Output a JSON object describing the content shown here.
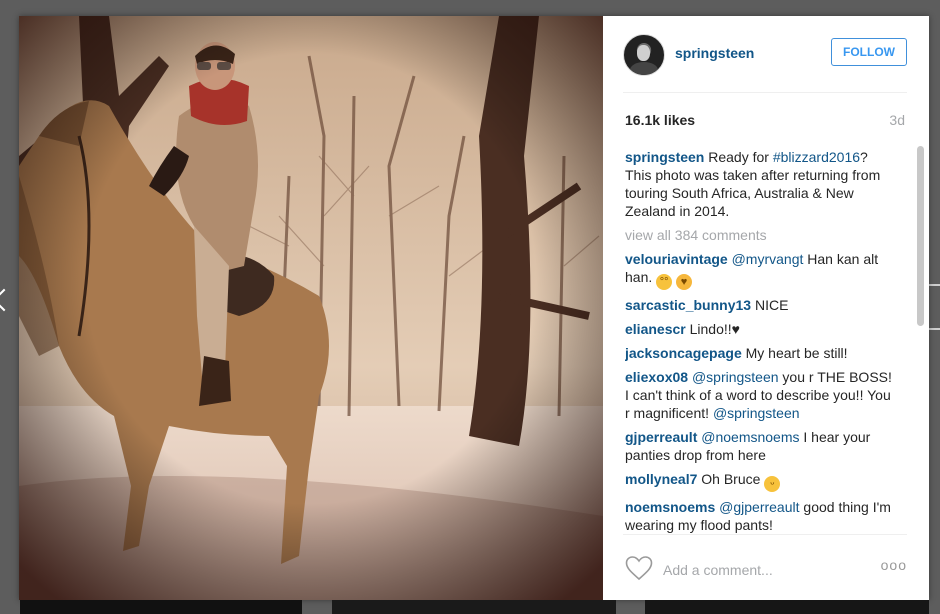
{
  "post": {
    "username": "springsteen",
    "follow_label": "FOLLOW",
    "likes": "16.1k likes",
    "age": "3d",
    "caption": {
      "user": "springsteen",
      "text_before": "Ready for ",
      "hashtag": "#blizzard2016",
      "text_after": "? This photo was taken after returning from touring South Africa, Australia & New Zealand in 2014."
    },
    "view_all": "view all 384 comments"
  },
  "comments": [
    {
      "user": "velouriavintage",
      "mention": "@myrvangt",
      "text": " Han kan alt han. "
    },
    {
      "user": "sarcastic_bunny13",
      "text": "NICE"
    },
    {
      "user": "elianescr",
      "text": "Lindo!!♥"
    },
    {
      "user": "jacksoncagepage",
      "text": "My heart be still!"
    },
    {
      "user": "eliexox08",
      "mention": "@springsteen",
      "text": " you r THE BOSS! I can't think of a word to describe you!! You r magnificent! ",
      "mention2": "@springsteen"
    },
    {
      "user": "gjperreault",
      "mention": "@noemsnoems",
      "text": " I hear your panties drop from here"
    },
    {
      "user": "mollyneal7",
      "text": "Oh Bruce "
    },
    {
      "user": "noemsnoems",
      "mention": "@gjperreault",
      "text": " good thing I'm wearing my flood pants!"
    }
  ],
  "footer": {
    "placeholder": "Add a comment...",
    "more": "ooo"
  },
  "icons": {
    "heart": "heart-icon",
    "more": "more-options-icon",
    "prev": "chevron-left-icon"
  },
  "colors": {
    "link": "#125688",
    "follow": "#3897f0",
    "muted": "#a5a7aa"
  }
}
